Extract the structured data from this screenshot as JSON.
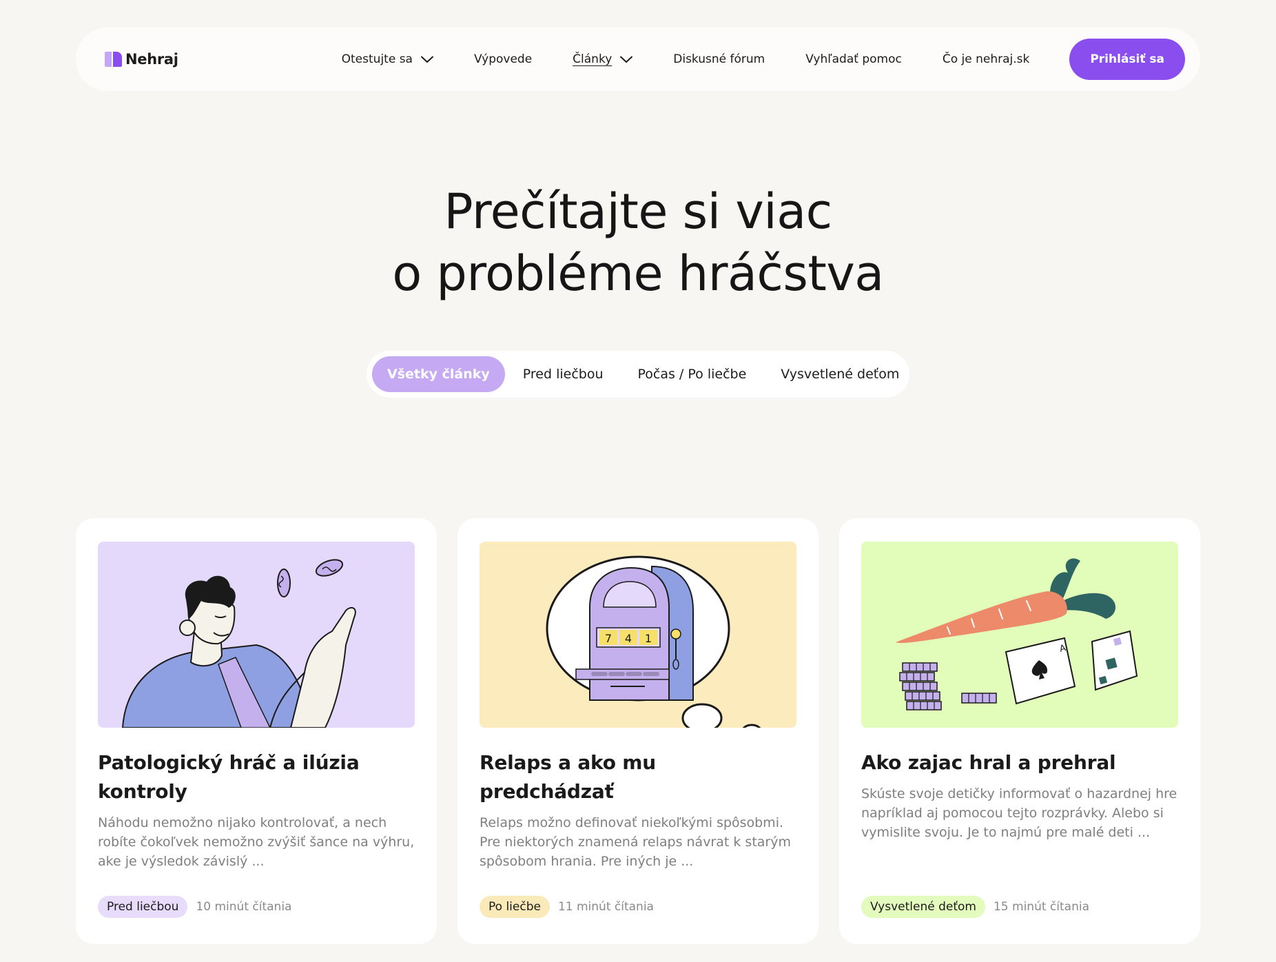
{
  "brand": {
    "name": "Nehraj",
    "accent": "#8a4dee",
    "accent_light": "#c3a6f7"
  },
  "nav": {
    "items": [
      {
        "label": "Otestujte sa",
        "has_dropdown": true,
        "icon": "chevron-down-icon"
      },
      {
        "label": "Výpovede"
      },
      {
        "label": "Články",
        "has_dropdown": true,
        "active": true,
        "icon": "chevron-down-icon"
      },
      {
        "label": "Diskusné fórum"
      },
      {
        "label": "Vyhľadať pomoc"
      },
      {
        "label": "Čo je nehraj.sk"
      }
    ],
    "login_label": "Prihlásiť sa"
  },
  "hero": {
    "title_line1": "Prečítajte si viac",
    "title_line2": "o probléme hráčstva"
  },
  "filters": {
    "tabs": [
      {
        "label": "Všetky články",
        "active": true
      },
      {
        "label": "Pred liečbou"
      },
      {
        "label": "Počas / Po liečbe"
      },
      {
        "label": "Vysvetlené deťom"
      }
    ]
  },
  "articles": [
    {
      "title": "Patologický hráč a ilúzia kontroly",
      "excerpt": "Náhodu nemožno nijako kontrolovať, a nech robíte čokoľvek nemožno zvýšiť šance na výhru, ake je výsledok závislý ...",
      "tag": "Pred liečbou",
      "tag_color": "#e7ddfb",
      "read_time": "10 minút čítania",
      "image_bg": "#e4d9fb"
    },
    {
      "title": "Relaps a ako mu predchádzať",
      "excerpt": "Relaps možno definovať niekoľkými spôsobmi. Pre niektorých znamená relaps návrat k starým spôsobom hrania. Pre iných je ...",
      "tag": "Po liečbe",
      "tag_color": "#faeab9",
      "read_time": "11 minút čítania",
      "image_bg": "#fbebbd",
      "slot_numbers": [
        "7",
        "4",
        "1"
      ]
    },
    {
      "title": "Ako zajac hral a prehral",
      "excerpt": "Skúste svoje detičky informovať o hazardnej hre napríklad aj pomocou tejto rozprávky. Alebo si vymislite svoju. Je to najmú pre malé deti ...",
      "tag": "Vysvetlené deťom",
      "tag_color": "#e3fbbd",
      "read_time": "15 minút čítania",
      "image_bg": "#e2fcb9",
      "card_letter": "A"
    }
  ]
}
